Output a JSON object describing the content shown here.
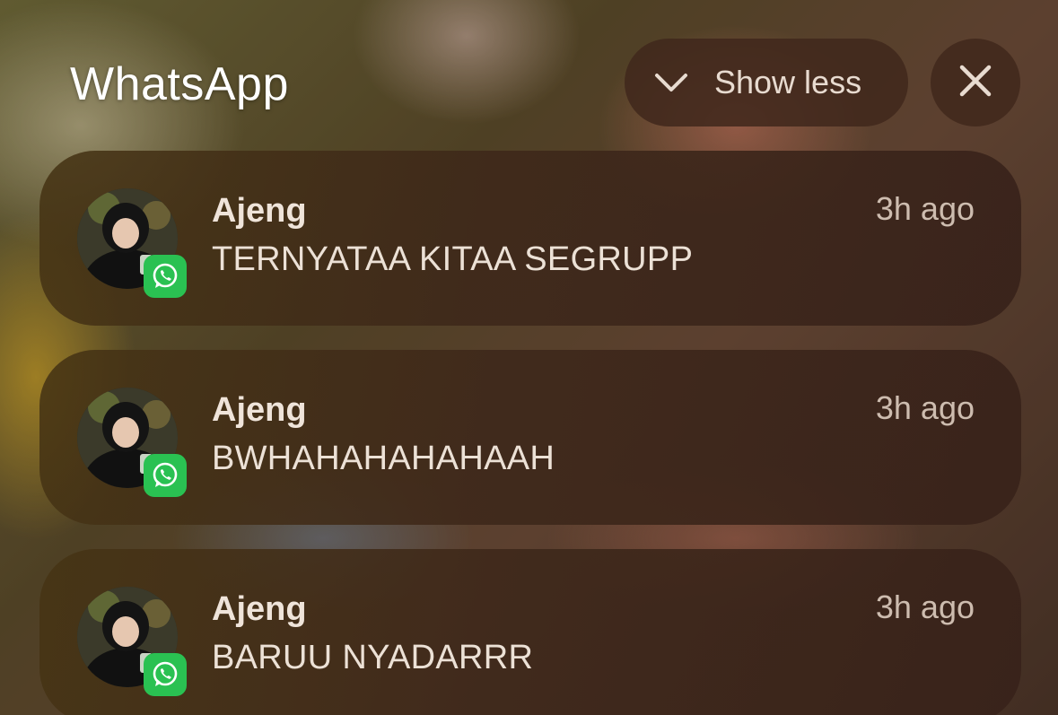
{
  "header": {
    "app_title": "WhatsApp",
    "show_less_label": "Show less"
  },
  "notifications": [
    {
      "sender": "Ajeng",
      "message": "TERNYATAA KITAA SEGRUPP",
      "time": "3h ago"
    },
    {
      "sender": "Ajeng",
      "message": "BWHAHAHAHAHAAH",
      "time": "3h ago"
    },
    {
      "sender": "Ajeng",
      "message": "BARUU NYADARRR",
      "time": "3h ago"
    }
  ],
  "icons": {
    "collapse": "chevron-down-icon",
    "close": "close-icon",
    "badge": "whatsapp-icon"
  },
  "colors": {
    "whatsapp_green": "#2ac152"
  }
}
